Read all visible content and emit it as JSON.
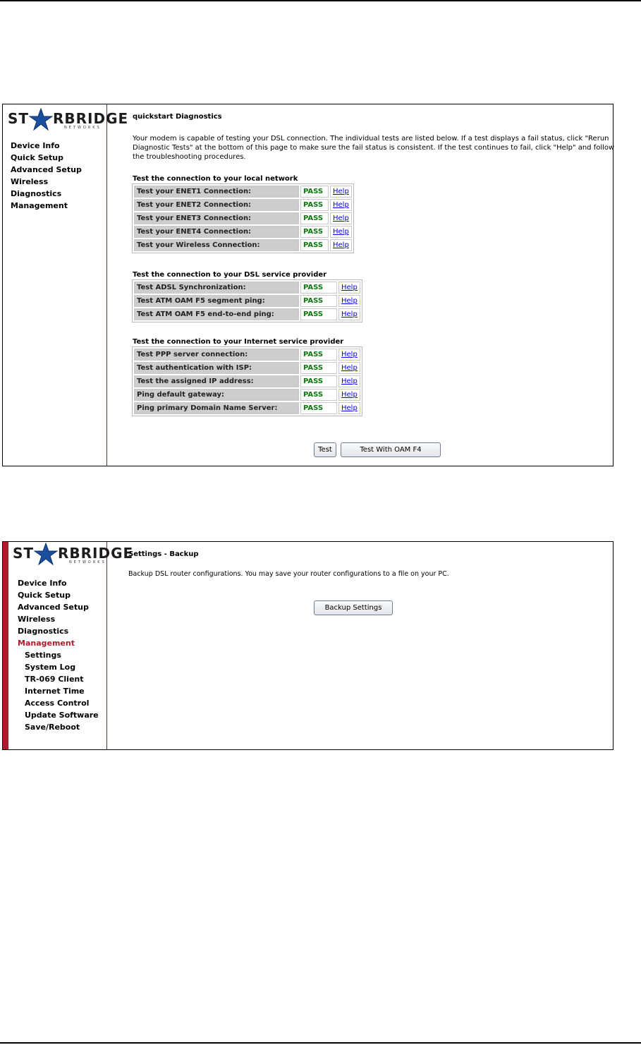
{
  "brand": {
    "logo_left": "ST",
    "logo_right": "RBRIDGE",
    "logo_sub": "NETWORKS"
  },
  "panel1": {
    "nav": [
      "Device Info",
      "Quick Setup",
      "Advanced Setup",
      "Wireless",
      "Diagnostics",
      "Management"
    ],
    "title": "quickstart Diagnostics",
    "description": "Your modem is capable of testing your DSL connection. The individual tests are listed below. If a test displays a fail status, click \"Rerun Diagnostic Tests\" at the bottom of this page to make sure the fail status is consistent. If the test continues to fail, click \"Help\" and follow the troubleshooting procedures.",
    "sections": [
      {
        "heading": "Test the connection to your local network",
        "rows": [
          {
            "label": "Test your ENET1 Connection:",
            "result": "PASS",
            "help": "Help"
          },
          {
            "label": "Test your ENET2 Connection:",
            "result": "PASS",
            "help": "Help"
          },
          {
            "label": "Test your ENET3 Connection:",
            "result": "PASS",
            "help": "Help"
          },
          {
            "label": "Test your ENET4 Connection:",
            "result": "PASS",
            "help": "Help"
          },
          {
            "label": "Test your Wireless Connection:",
            "result": "PASS",
            "help": "Help"
          }
        ]
      },
      {
        "heading": "Test the connection to your DSL service provider",
        "rows": [
          {
            "label": "Test ADSL Synchronization:",
            "result": "PASS",
            "help": "Help"
          },
          {
            "label": "Test ATM OAM F5 segment ping:",
            "result": "PASS",
            "help": "Help"
          },
          {
            "label": "Test ATM OAM F5 end-to-end ping:",
            "result": "PASS",
            "help": "Help"
          }
        ]
      },
      {
        "heading": "Test the connection to your Internet service provider",
        "rows": [
          {
            "label": "Test PPP server connection:",
            "result": "PASS",
            "help": "Help"
          },
          {
            "label": "Test authentication with ISP:",
            "result": "PASS",
            "help": "Help"
          },
          {
            "label": "Test the assigned IP address:",
            "result": "PASS",
            "help": "Help"
          },
          {
            "label": "Ping default gateway:",
            "result": "PASS",
            "help": "Help"
          },
          {
            "label": "Ping primary Domain Name Server:",
            "result": "PASS",
            "help": "Help"
          }
        ]
      }
    ],
    "buttons": {
      "test": "Test",
      "test_oam": "Test With OAM F4"
    }
  },
  "panel2": {
    "nav": [
      "Device Info",
      "Quick Setup",
      "Advanced Setup",
      "Wireless",
      "Diagnostics",
      "Management"
    ],
    "subnav": [
      "Settings",
      "System Log",
      "TR-069 Client",
      "Internet Time",
      "Access Control",
      "Update Software",
      "Save/Reboot"
    ],
    "active_nav": "Management",
    "title": "Settings - Backup",
    "description": "Backup DSL router configurations. You may save your router configurations to a file on your PC.",
    "button": "Backup Settings"
  },
  "colors": {
    "accent": "#b01c2e",
    "pass": "#0a7a0a",
    "link": "#0000ee",
    "star": "#1a4fa0"
  }
}
